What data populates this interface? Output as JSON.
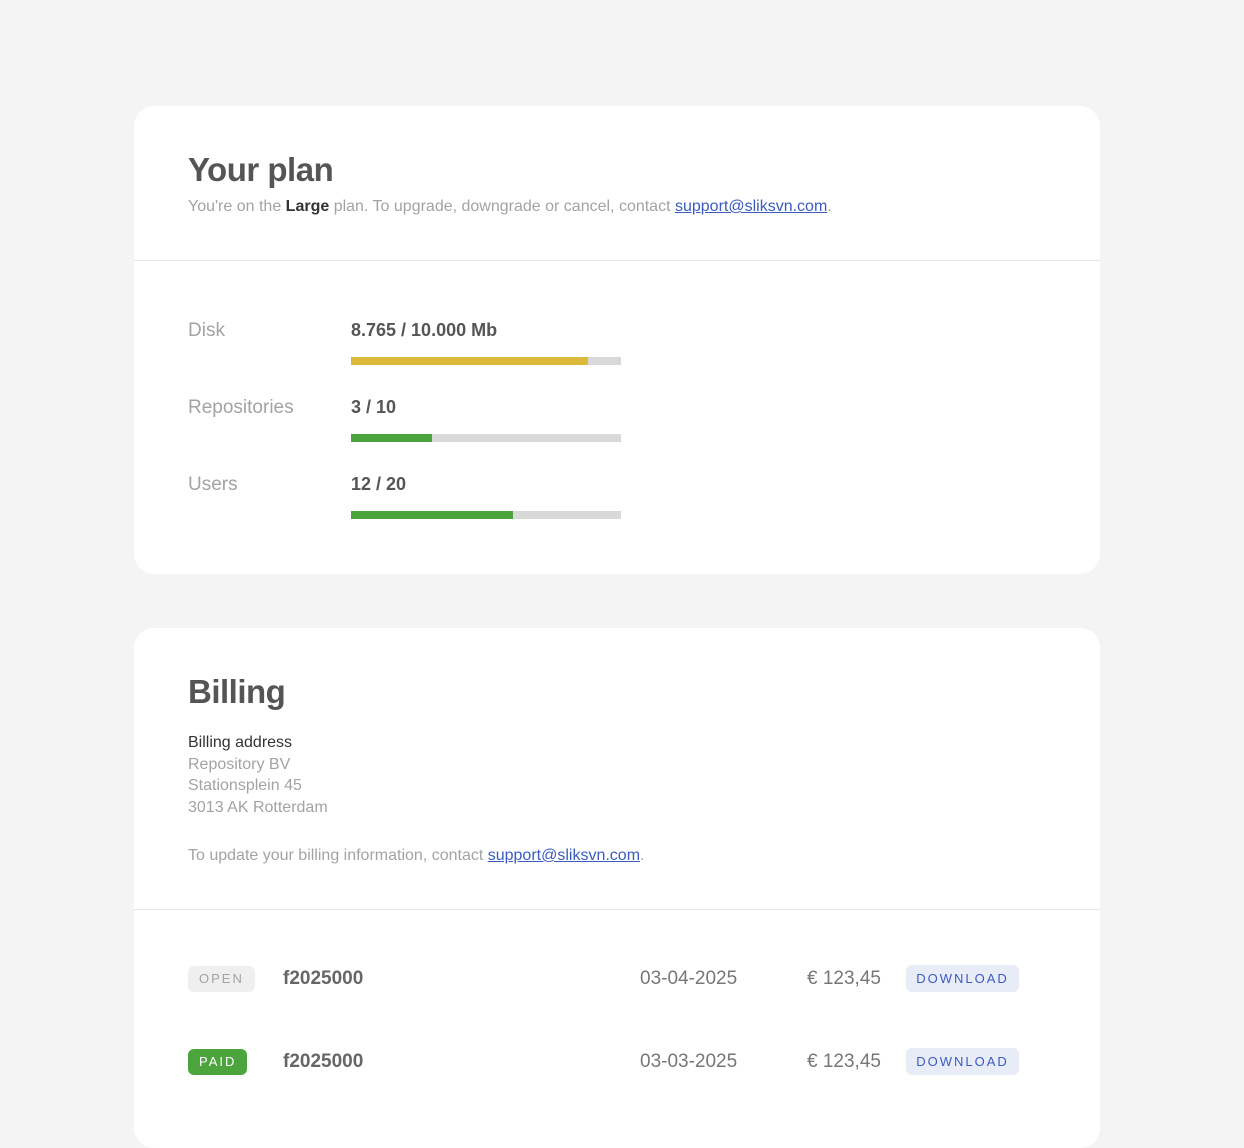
{
  "plan": {
    "title": "Your plan",
    "subtitle_prefix": "You're on the",
    "plan_name": "Large",
    "subtitle_middle": "plan. To upgrade, downgrade or cancel, contact",
    "support_email": "support@sliksvn.com",
    "subtitle_suffix": ".",
    "usage": [
      {
        "label": "Disk",
        "value": "8.765 / 10.000 Mb",
        "fraction": 0.8765,
        "color": "#dcb93a"
      },
      {
        "label": "Repositories",
        "value": "3 / 10",
        "fraction": 0.3,
        "color": "#4ca43c"
      },
      {
        "label": "Users",
        "value": "12 / 20",
        "fraction": 0.6,
        "color": "#4ca43c"
      }
    ]
  },
  "billing": {
    "title": "Billing",
    "address_heading": "Billing address",
    "address_lines": [
      "Repository BV",
      "Stationsplein 45",
      "3013 AK Rotterdam"
    ],
    "update_prefix": "To update your billing information, contact",
    "support_email": "support@sliksvn.com",
    "update_suffix": ".",
    "invoices": [
      {
        "status": "OPEN",
        "number": "f2025000",
        "date": "03-04-2025",
        "amount": "€ 123,45",
        "action": "DOWNLOAD"
      },
      {
        "status": "PAID",
        "number": "f2025000",
        "date": "03-03-2025",
        "amount": "€ 123,45",
        "action": "DOWNLOAD"
      }
    ]
  }
}
